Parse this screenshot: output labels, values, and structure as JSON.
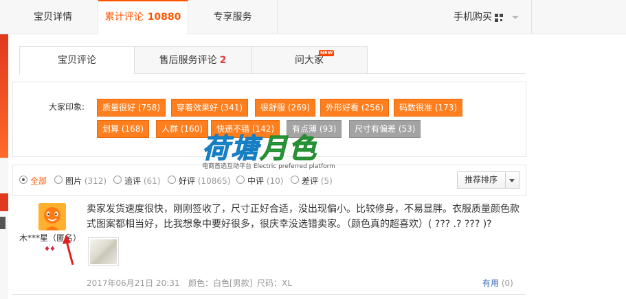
{
  "top_tabs": {
    "details": "宝贝详情",
    "reviews_label": "累计评论",
    "reviews_count": "10880",
    "service": "专享服务",
    "mobile_buy": "手机购买"
  },
  "sub_tabs": {
    "reviews": "宝贝评论",
    "after_sale": "售后服务评论",
    "after_sale_count": "2",
    "ask": "问大家",
    "ask_badge": "NEW"
  },
  "impressions": {
    "label": "大家印象:",
    "tags": [
      {
        "text": "质量很好 (758)",
        "style": "orange"
      },
      {
        "text": "穿着效果好 (341)",
        "style": "orange"
      },
      {
        "text": "很舒服 (269)",
        "style": "orange"
      },
      {
        "text": "外形好看 (256)",
        "style": "orange"
      },
      {
        "text": "码数很准 (173)",
        "style": "orange"
      },
      {
        "text": "划算 (168)",
        "style": "orange"
      },
      {
        "text": "人群 (160)",
        "style": "orange"
      },
      {
        "text": "快递不错 (142)",
        "style": "orange"
      },
      {
        "text": "有点薄 (93)",
        "style": "gray"
      },
      {
        "text": "尺寸有偏差 (53)",
        "style": "gray"
      }
    ]
  },
  "filters": {
    "all": "全部",
    "pictures": "图片",
    "pictures_count": "(312)",
    "followup": "追评",
    "followup_count": "(61)",
    "good": "好评",
    "good_count": "(10865)",
    "medium": "中评",
    "medium_count": "(10)",
    "bad": "差评",
    "bad_count": "(5)",
    "sort": "推荐排序"
  },
  "review": {
    "user": "木***星（匿名）",
    "rating_icons": "♦♦",
    "text": "卖家发货速度很快，刚刚签收了，尺寸正好合适，没出现偏小。比较修身，不易显胖。衣服质量颜色款式图案都相当好，比我想象中要好很多，很庆幸没选错卖家。（颜色真的超喜欢）( ??? .? ??? )?",
    "date": "2017年06月21日 20:31",
    "color": "颜色：白色[男款]",
    "size": "尺码：XL",
    "useful": "有用",
    "useful_count": "(0)"
  },
  "watermark": {
    "logo_a": "荷塘",
    "logo_b": "月色",
    "tagline": "电商首选互动平台 Electric preferred platform"
  },
  "colors": {
    "accent": "#ff5500",
    "tag_orange": "#ff7f1e",
    "tag_gray": "#a3a3a3",
    "link_blue": "#3d6cb5"
  }
}
